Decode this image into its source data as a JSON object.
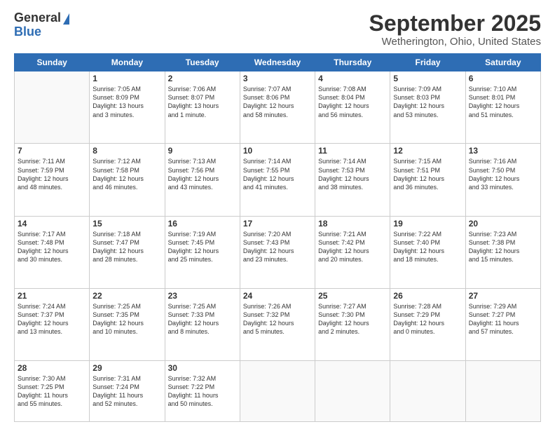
{
  "logo": {
    "general": "General",
    "blue": "Blue"
  },
  "header": {
    "month": "September 2025",
    "location": "Wetherington, Ohio, United States"
  },
  "weekdays": [
    "Sunday",
    "Monday",
    "Tuesday",
    "Wednesday",
    "Thursday",
    "Friday",
    "Saturday"
  ],
  "weeks": [
    [
      {
        "day": "",
        "lines": []
      },
      {
        "day": "1",
        "lines": [
          "Sunrise: 7:05 AM",
          "Sunset: 8:09 PM",
          "Daylight: 13 hours",
          "and 3 minutes."
        ]
      },
      {
        "day": "2",
        "lines": [
          "Sunrise: 7:06 AM",
          "Sunset: 8:07 PM",
          "Daylight: 13 hours",
          "and 1 minute."
        ]
      },
      {
        "day": "3",
        "lines": [
          "Sunrise: 7:07 AM",
          "Sunset: 8:06 PM",
          "Daylight: 12 hours",
          "and 58 minutes."
        ]
      },
      {
        "day": "4",
        "lines": [
          "Sunrise: 7:08 AM",
          "Sunset: 8:04 PM",
          "Daylight: 12 hours",
          "and 56 minutes."
        ]
      },
      {
        "day": "5",
        "lines": [
          "Sunrise: 7:09 AM",
          "Sunset: 8:03 PM",
          "Daylight: 12 hours",
          "and 53 minutes."
        ]
      },
      {
        "day": "6",
        "lines": [
          "Sunrise: 7:10 AM",
          "Sunset: 8:01 PM",
          "Daylight: 12 hours",
          "and 51 minutes."
        ]
      }
    ],
    [
      {
        "day": "7",
        "lines": [
          "Sunrise: 7:11 AM",
          "Sunset: 7:59 PM",
          "Daylight: 12 hours",
          "and 48 minutes."
        ]
      },
      {
        "day": "8",
        "lines": [
          "Sunrise: 7:12 AM",
          "Sunset: 7:58 PM",
          "Daylight: 12 hours",
          "and 46 minutes."
        ]
      },
      {
        "day": "9",
        "lines": [
          "Sunrise: 7:13 AM",
          "Sunset: 7:56 PM",
          "Daylight: 12 hours",
          "and 43 minutes."
        ]
      },
      {
        "day": "10",
        "lines": [
          "Sunrise: 7:14 AM",
          "Sunset: 7:55 PM",
          "Daylight: 12 hours",
          "and 41 minutes."
        ]
      },
      {
        "day": "11",
        "lines": [
          "Sunrise: 7:14 AM",
          "Sunset: 7:53 PM",
          "Daylight: 12 hours",
          "and 38 minutes."
        ]
      },
      {
        "day": "12",
        "lines": [
          "Sunrise: 7:15 AM",
          "Sunset: 7:51 PM",
          "Daylight: 12 hours",
          "and 36 minutes."
        ]
      },
      {
        "day": "13",
        "lines": [
          "Sunrise: 7:16 AM",
          "Sunset: 7:50 PM",
          "Daylight: 12 hours",
          "and 33 minutes."
        ]
      }
    ],
    [
      {
        "day": "14",
        "lines": [
          "Sunrise: 7:17 AM",
          "Sunset: 7:48 PM",
          "Daylight: 12 hours",
          "and 30 minutes."
        ]
      },
      {
        "day": "15",
        "lines": [
          "Sunrise: 7:18 AM",
          "Sunset: 7:47 PM",
          "Daylight: 12 hours",
          "and 28 minutes."
        ]
      },
      {
        "day": "16",
        "lines": [
          "Sunrise: 7:19 AM",
          "Sunset: 7:45 PM",
          "Daylight: 12 hours",
          "and 25 minutes."
        ]
      },
      {
        "day": "17",
        "lines": [
          "Sunrise: 7:20 AM",
          "Sunset: 7:43 PM",
          "Daylight: 12 hours",
          "and 23 minutes."
        ]
      },
      {
        "day": "18",
        "lines": [
          "Sunrise: 7:21 AM",
          "Sunset: 7:42 PM",
          "Daylight: 12 hours",
          "and 20 minutes."
        ]
      },
      {
        "day": "19",
        "lines": [
          "Sunrise: 7:22 AM",
          "Sunset: 7:40 PM",
          "Daylight: 12 hours",
          "and 18 minutes."
        ]
      },
      {
        "day": "20",
        "lines": [
          "Sunrise: 7:23 AM",
          "Sunset: 7:38 PM",
          "Daylight: 12 hours",
          "and 15 minutes."
        ]
      }
    ],
    [
      {
        "day": "21",
        "lines": [
          "Sunrise: 7:24 AM",
          "Sunset: 7:37 PM",
          "Daylight: 12 hours",
          "and 13 minutes."
        ]
      },
      {
        "day": "22",
        "lines": [
          "Sunrise: 7:25 AM",
          "Sunset: 7:35 PM",
          "Daylight: 12 hours",
          "and 10 minutes."
        ]
      },
      {
        "day": "23",
        "lines": [
          "Sunrise: 7:25 AM",
          "Sunset: 7:33 PM",
          "Daylight: 12 hours",
          "and 8 minutes."
        ]
      },
      {
        "day": "24",
        "lines": [
          "Sunrise: 7:26 AM",
          "Sunset: 7:32 PM",
          "Daylight: 12 hours",
          "and 5 minutes."
        ]
      },
      {
        "day": "25",
        "lines": [
          "Sunrise: 7:27 AM",
          "Sunset: 7:30 PM",
          "Daylight: 12 hours",
          "and 2 minutes."
        ]
      },
      {
        "day": "26",
        "lines": [
          "Sunrise: 7:28 AM",
          "Sunset: 7:29 PM",
          "Daylight: 12 hours",
          "and 0 minutes."
        ]
      },
      {
        "day": "27",
        "lines": [
          "Sunrise: 7:29 AM",
          "Sunset: 7:27 PM",
          "Daylight: 11 hours",
          "and 57 minutes."
        ]
      }
    ],
    [
      {
        "day": "28",
        "lines": [
          "Sunrise: 7:30 AM",
          "Sunset: 7:25 PM",
          "Daylight: 11 hours",
          "and 55 minutes."
        ]
      },
      {
        "day": "29",
        "lines": [
          "Sunrise: 7:31 AM",
          "Sunset: 7:24 PM",
          "Daylight: 11 hours",
          "and 52 minutes."
        ]
      },
      {
        "day": "30",
        "lines": [
          "Sunrise: 7:32 AM",
          "Sunset: 7:22 PM",
          "Daylight: 11 hours",
          "and 50 minutes."
        ]
      },
      {
        "day": "",
        "lines": []
      },
      {
        "day": "",
        "lines": []
      },
      {
        "day": "",
        "lines": []
      },
      {
        "day": "",
        "lines": []
      }
    ]
  ]
}
